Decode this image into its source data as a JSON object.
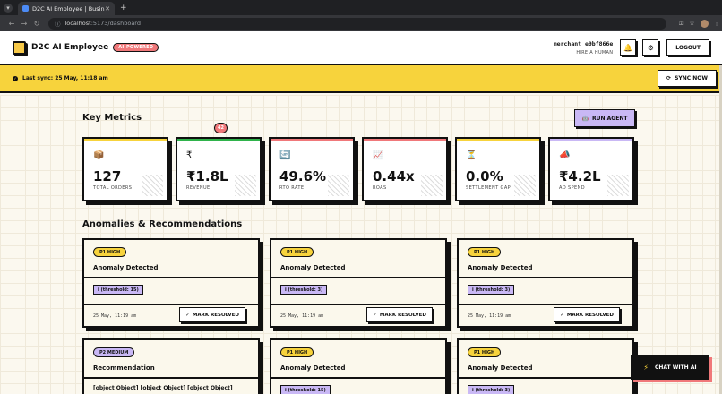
{
  "browser": {
    "tab_title": "D2C AI Employee | Busin",
    "url_host": "localhost",
    "url_path": ":5173/dashboard"
  },
  "header": {
    "brand": "D2C AI Employee",
    "ai_badge": "AI-POWERED",
    "merchant_id": "merchant_e9bf866e",
    "merchant_role": "HIRE A HUMAN",
    "logout_label": "LOGOUT"
  },
  "sync": {
    "text": "Last sync: 25 May, 11:18 am",
    "button_label": "SYNC NOW"
  },
  "metrics": {
    "title": "Key Metrics",
    "run_agent_label": "RUN AGENT",
    "cards": [
      {
        "icon": "📦",
        "value": "127",
        "label": "TOTAL ORDERS",
        "accent": "#f7d33c"
      },
      {
        "icon": "₹",
        "value": "₹1.8L",
        "label": "REVENUE",
        "accent": "#2fb34b"
      },
      {
        "icon": "🔄",
        "value": "49.6%",
        "label": "RTO RATE",
        "accent": "#f0787a"
      },
      {
        "icon": "📈",
        "value": "0.44x",
        "label": "ROAS",
        "accent": "#f0787a"
      },
      {
        "icon": "⏳",
        "value": "0.0%",
        "label": "SETTLEMENT GAP",
        "accent": "#f7d33c"
      },
      {
        "icon": "📣",
        "value": "₹4.2L",
        "label": "AD SPEND",
        "accent": "#c9b8f5"
      }
    ]
  },
  "anomalies": {
    "title": "Anomalies & Recommendations",
    "count": "42",
    "cards": [
      {
        "priority": "P1 HIGH",
        "title": "Anomaly Detected",
        "tag": "i (threshold: 15)",
        "time": "25 May, 11:19 am",
        "action": "MARK RESOLVED"
      },
      {
        "priority": "P1 HIGH",
        "title": "Anomaly Detected",
        "tag": "i (threshold: 3)",
        "time": "25 May, 11:19 am",
        "action": "MARK RESOLVED"
      },
      {
        "priority": "P1 HIGH",
        "title": "Anomaly Detected",
        "tag": "i (threshold: 3)",
        "time": "25 May, 11:19 am",
        "action": "MARK RESOLVED"
      },
      {
        "priority": "P2 MEDIUM",
        "title": "Recommendation",
        "body": "[object Object] [object Object] [object Object]"
      },
      {
        "priority": "P1 HIGH",
        "title": "Anomaly Detected",
        "tag": "i (threshold: 15)"
      },
      {
        "priority": "P1 HIGH",
        "title": "Anomaly Detected",
        "tag": "i (threshold: 3)"
      }
    ]
  },
  "chat": {
    "label": "CHAT WITH AI"
  }
}
